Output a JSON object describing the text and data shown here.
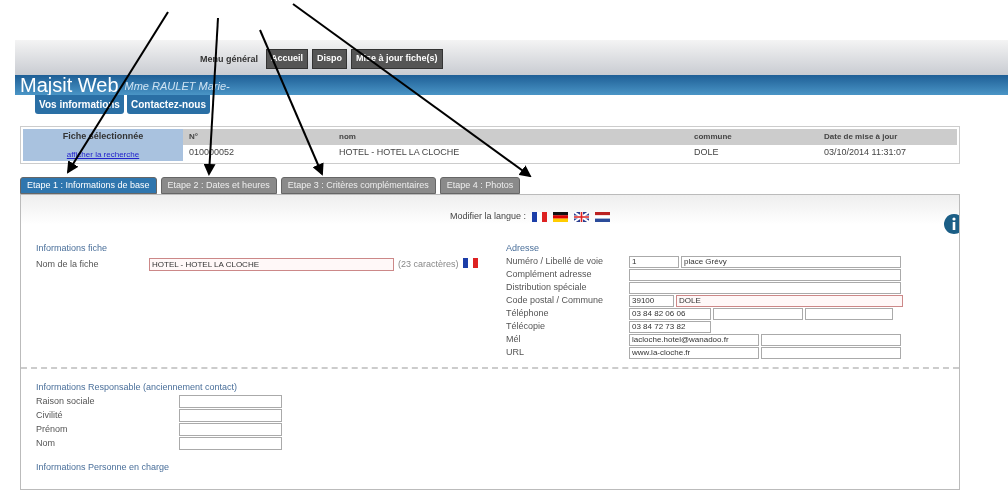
{
  "top_menu": {
    "label": "Menu général",
    "buttons": [
      "Accueil",
      "Dispo",
      "Mise à jour fiche(s)"
    ]
  },
  "header": {
    "title": "Majsit Web",
    "user": "Mme RAULET Marie-"
  },
  "header_buttons": [
    "Vos informations",
    "Contactez-nous"
  ],
  "selected_record": {
    "heading": "Fiche sélectionnée",
    "link": "afficher la recherche",
    "columns": [
      "N°",
      "nom",
      "commune",
      "Date de mise à jour"
    ],
    "values": [
      "010000052",
      "HOTEL - HOTEL LA CLOCHE",
      "DOLE",
      "03/10/2014 11:31:07"
    ]
  },
  "tabs": [
    {
      "label": "Etape 1 : Informations de base",
      "selected": true
    },
    {
      "label": "Etape 2 : Dates et heures",
      "selected": false
    },
    {
      "label": "Etape 3 : Critères complémentaires",
      "selected": false
    },
    {
      "label": "Etape 4 : Photos",
      "selected": false
    }
  ],
  "language": {
    "label": "Modifier la langue :",
    "flags": [
      {
        "kind": "fr"
      },
      {
        "kind": "de"
      },
      {
        "kind": "gb"
      },
      {
        "kind": "nl"
      }
    ]
  },
  "fiche": {
    "heading": "Informations fiche",
    "name_label": "Nom de la fiche",
    "name_value": "HOTEL - HOTEL LA CLOCHE",
    "required": true,
    "count": "(23 caractères)",
    "flag": {
      "kind": "fr"
    }
  },
  "address": {
    "heading": "Adresse",
    "rows": [
      {
        "label": "Numéro / Libellé de voie",
        "fields": [
          {
            "value": "1",
            "required": false
          },
          {
            "value": "place Grévy",
            "required": false
          }
        ]
      },
      {
        "label": "Complément adresse",
        "fields": [
          {
            "required": false
          }
        ]
      },
      {
        "label": "Distribution spéciale",
        "fields": [
          {
            "required": false
          }
        ]
      },
      {
        "label": "Code postal / Commune",
        "fields": [
          {
            "value": "39100",
            "required": false
          },
          {
            "value": "DOLE",
            "required": true
          }
        ]
      },
      {
        "label": "Téléphone",
        "fields": [
          {
            "value": "03 84 82 06 06",
            "required": false
          },
          {
            "required": false
          },
          {
            "required": false
          }
        ]
      },
      {
        "label": "Télécopie",
        "fields": [
          {
            "value": "03 84 72 73 82",
            "required": false
          }
        ]
      },
      {
        "label": "Mél",
        "fields": [
          {
            "value": "lacloche.hotel@wanadoo.fr",
            "required": false
          },
          {
            "required": false
          }
        ]
      },
      {
        "label": "URL",
        "fields": [
          {
            "value": "www.la-cloche.fr",
            "required": false
          },
          {
            "required": false
          }
        ]
      }
    ]
  },
  "responsible": {
    "heading": "Informations Responsable (anciennement contact)",
    "fields": [
      "Raison sociale",
      "Civilité",
      "Prénom",
      "Nom"
    ]
  },
  "next_heading": "Informations Personne en charge"
}
